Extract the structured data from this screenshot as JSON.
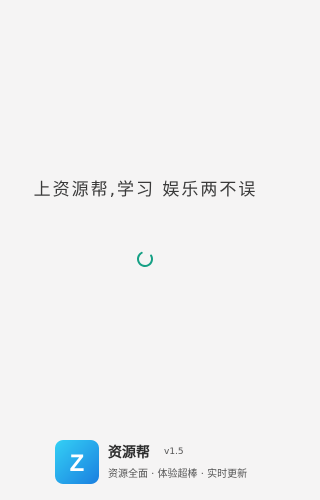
{
  "splash": {
    "tagline": "上资源帮,学习 娱乐两不误"
  },
  "brand": {
    "logo_letter": "Z",
    "app_name": "资源帮",
    "version": "v1.5",
    "slogan": "资源全面 · 体验超棒 · 实时更新"
  },
  "colors": {
    "background": "#f5f4f4",
    "spinner": "#16a085",
    "logo_gradient_top": "#2ec4f0",
    "logo_gradient_bottom": "#1e88e5"
  },
  "icons": {
    "spinner": "loading-spinner-icon",
    "logo": "z-logo-icon"
  }
}
